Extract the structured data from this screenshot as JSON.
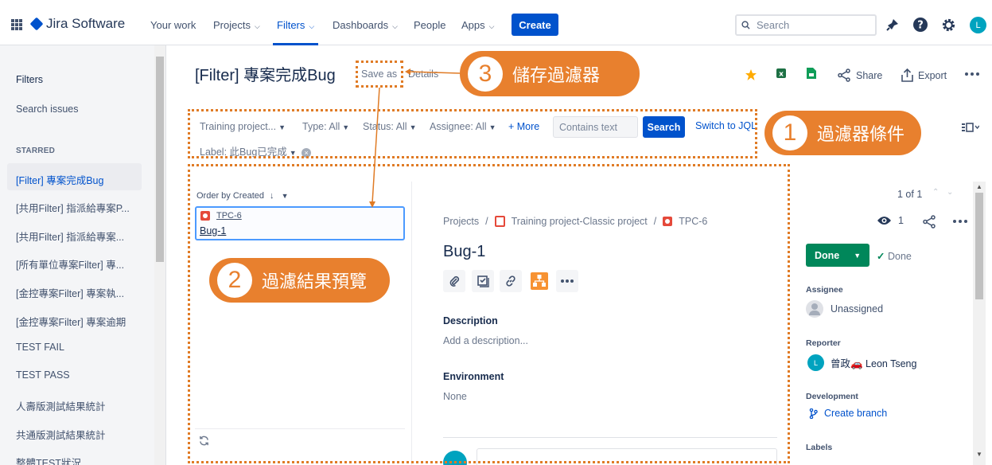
{
  "app": {
    "name": "Jira Software"
  },
  "nav": {
    "items": [
      {
        "label": "Your work",
        "has_chevron": false
      },
      {
        "label": "Projects",
        "has_chevron": true
      },
      {
        "label": "Filters",
        "has_chevron": true,
        "active": true
      },
      {
        "label": "Dashboards",
        "has_chevron": true
      },
      {
        "label": "People",
        "has_chevron": false
      },
      {
        "label": "Apps",
        "has_chevron": true
      }
    ],
    "create_label": "Create",
    "search_placeholder": "Search",
    "avatar_initial": "L"
  },
  "sidebar": {
    "filters_label": "Filters",
    "search_issues_label": "Search issues",
    "starred_heading": "STARRED",
    "starred_items": [
      "[Filter] 專案完成Bug",
      "[共用Filter] 指派給專案P...",
      "[共用Filter] 指派給專案...",
      "[所有單位專案Filter] 專...",
      "[金控專案Filter] 專案執...",
      "[金控專案Filter] 專案逾期",
      "TEST FAIL",
      "TEST PASS",
      "人壽版測試結果統計",
      "共通版測試結果統計",
      "整體TEST狀況"
    ],
    "selected_index": 0
  },
  "header": {
    "title": "[Filter] 專案完成Bug",
    "save_as": "Save as",
    "details": "Details",
    "share": "Share",
    "export": "Export"
  },
  "filter_bar": {
    "project": "Training project...",
    "type": "Type: All",
    "status": "Status: All",
    "assignee": "Assignee: All",
    "more": "+ More",
    "contains_placeholder": "Contains text",
    "search_button": "Search",
    "switch_jql": "Switch to JQL",
    "label": "Label: 此Bug已完成"
  },
  "annotations": {
    "one": {
      "num": "1",
      "text": "過濾器條件"
    },
    "two": {
      "num": "2",
      "text": "過濾結果預覽"
    },
    "three": {
      "num": "3",
      "text": "儲存過濾器"
    }
  },
  "list": {
    "order_by": "Order by Created",
    "issue_key": "TPC-6",
    "issue_summary": "Bug-1"
  },
  "detail": {
    "breadcrumb_projects": "Projects",
    "breadcrumb_project": "Training project-Classic project",
    "breadcrumb_issue": "TPC-6",
    "title": "Bug-1",
    "description_label": "Description",
    "description_placeholder": "Add a description...",
    "environment_label": "Environment",
    "environment_value": "None"
  },
  "right_panel": {
    "pagination": "1 of 1",
    "watch_count": "1",
    "status_button": "Done",
    "status_text": "Done",
    "assignee_label": "Assignee",
    "assignee_value": "Unassigned",
    "reporter_label": "Reporter",
    "reporter_initial": "L",
    "reporter_value": "曾政🚗 Leon Tseng",
    "development_label": "Development",
    "create_branch": "Create branch",
    "labels_label": "Labels"
  },
  "colors": {
    "accent": "#0052cc",
    "annotation": "#e8802e",
    "done": "#00875a"
  }
}
